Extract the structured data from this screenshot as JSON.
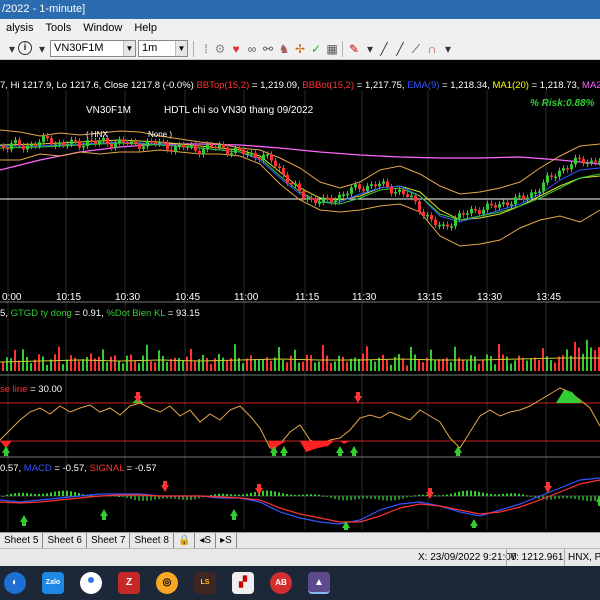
{
  "window": {
    "title": "/2022 - 1-minute]"
  },
  "menu": {
    "items": [
      "alysis",
      "Tools",
      "Window",
      "Help"
    ]
  },
  "toolbar": {
    "symbol_value": "VN30F1M",
    "interval_value": "1m",
    "icons": [
      "help-icon",
      "settings-icon",
      "heart-icon",
      "glasses-icon",
      "binoculars-icon",
      "person-icon",
      "crosshair-icon",
      "check-icon",
      "grid-icon",
      "color-pen-icon",
      "line-draw-icon",
      "line-draw2-icon",
      "magnet-icon",
      "tool-icon"
    ]
  },
  "chart_header": {
    "ohlc_text": "7, Hi 1217.9, Lo 1217.6, Close 1217.8 (-0.0%)",
    "bbtop_label": "BBTop(15,2)",
    "bbtop_value": " = 1,219.09, ",
    "bbbot_label": "BBBot(15,2)",
    "bbbot_value": " = 1,217.75, ",
    "ema_label": "EMA(9)",
    "ema_value": " = 1,218.34, ",
    "ma1_label": "MA1(20)",
    "ma1_value": " = 1,218.73, ",
    "ma2_label": "MA2(",
    "symbol_title": "VN30F1M",
    "description": "HDTL chi so VN30 thang 09/2022",
    "exchange": "( HNX",
    "none_label": "None )",
    "risk": "% Risk:0.88%"
  },
  "time_axis": [
    "0:00",
    "10:15",
    "10:30",
    "10:45",
    "11:00",
    "11:15",
    "11:30",
    "13:15",
    "13:30",
    "13:45"
  ],
  "volume_panel": {
    "label_prefix": "5, ",
    "gtgd_label": "GTGD ty dong",
    "gtgd_value": " = 0.91, ",
    "dotbien_label": "%Dot Bien KL",
    "dotbien_value": " = 93.15"
  },
  "rsi_panel": {
    "label": "se line",
    "value": " = 30.00"
  },
  "macd_panel": {
    "prefix": "0.57, ",
    "macd_label": "MACD",
    "macd_value": " = -0.57, ",
    "signal_label": "SIGNAL",
    "signal_value": " = -0.57"
  },
  "sheet_tabs": [
    "Sheet 5",
    "Sheet 6",
    "Sheet 7",
    "Sheet 8"
  ],
  "statusbar": {
    "x_readout": "X: 23/09/2022 9:21:00",
    "y_readout": "Y: 1212.961",
    "exchange": "HNX, Ph"
  },
  "taskbar": {
    "apps": [
      "Zalo",
      "Chrome",
      "WinRAR",
      "Lixi",
      "Livescore",
      "App",
      "Ami",
      "AmiBroker"
    ]
  },
  "colors": {
    "bbtop": "#ff3333",
    "bbbot": "#ff3333",
    "ema": "#3333ff",
    "ma1": "#ffff00",
    "ma2": "#ff66ff",
    "gtgd": "#33cc33",
    "dotbien": "#33cc33",
    "macd": "#3333ff",
    "signal": "#ff3333",
    "risk": "#33cc33"
  }
}
